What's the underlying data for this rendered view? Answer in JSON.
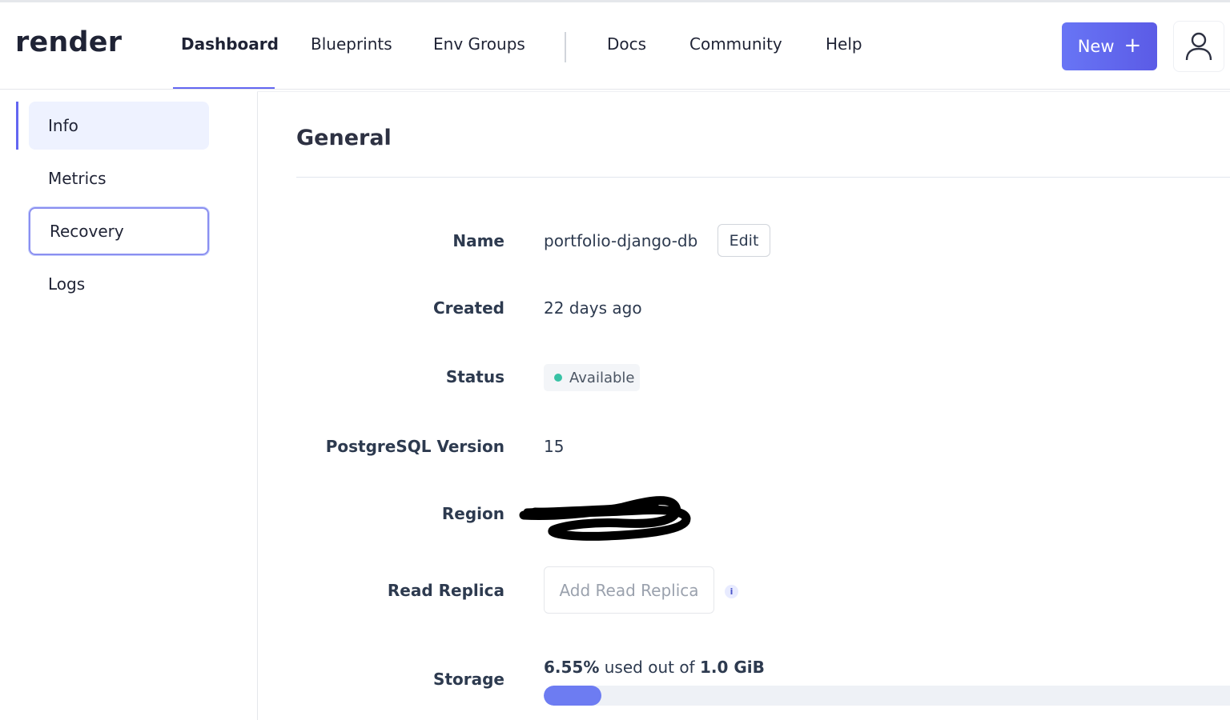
{
  "app": {
    "logo": "render"
  },
  "nav": {
    "items": [
      {
        "label": "Dashboard",
        "active": true
      },
      {
        "label": "Blueprints"
      },
      {
        "label": "Env Groups"
      },
      {
        "label": "Docs"
      },
      {
        "label": "Community"
      },
      {
        "label": "Help"
      }
    ],
    "new_button": {
      "label": "New",
      "icon": "plus-icon"
    },
    "avatar_icon": "user-icon"
  },
  "sidebar": {
    "items": [
      {
        "label": "Info",
        "state": "active"
      },
      {
        "label": "Metrics"
      },
      {
        "label": "Recovery",
        "state": "focused"
      },
      {
        "label": "Logs"
      }
    ]
  },
  "general": {
    "title": "General",
    "name": {
      "label": "Name",
      "value": "portfolio-django-db",
      "edit_label": "Edit"
    },
    "created": {
      "label": "Created",
      "value": "22 days ago"
    },
    "status": {
      "label": "Status",
      "value": "Available",
      "color": "#38c2a5"
    },
    "postgres": {
      "label": "PostgreSQL Version",
      "value": "15"
    },
    "region": {
      "label": "Region",
      "value": "",
      "redacted": true
    },
    "read_replica": {
      "label": "Read Replica",
      "button_label": "Add Read Replica",
      "info_icon": "info-icon"
    },
    "storage": {
      "label": "Storage",
      "used_percent": "6.55%",
      "middle_text": " used out of ",
      "total": "1.0 GiB",
      "fraction_used": 0.0655
    }
  },
  "colors": {
    "accent": "#6366f1",
    "button": "#5b5be6",
    "progress": "#6d7cf2"
  }
}
